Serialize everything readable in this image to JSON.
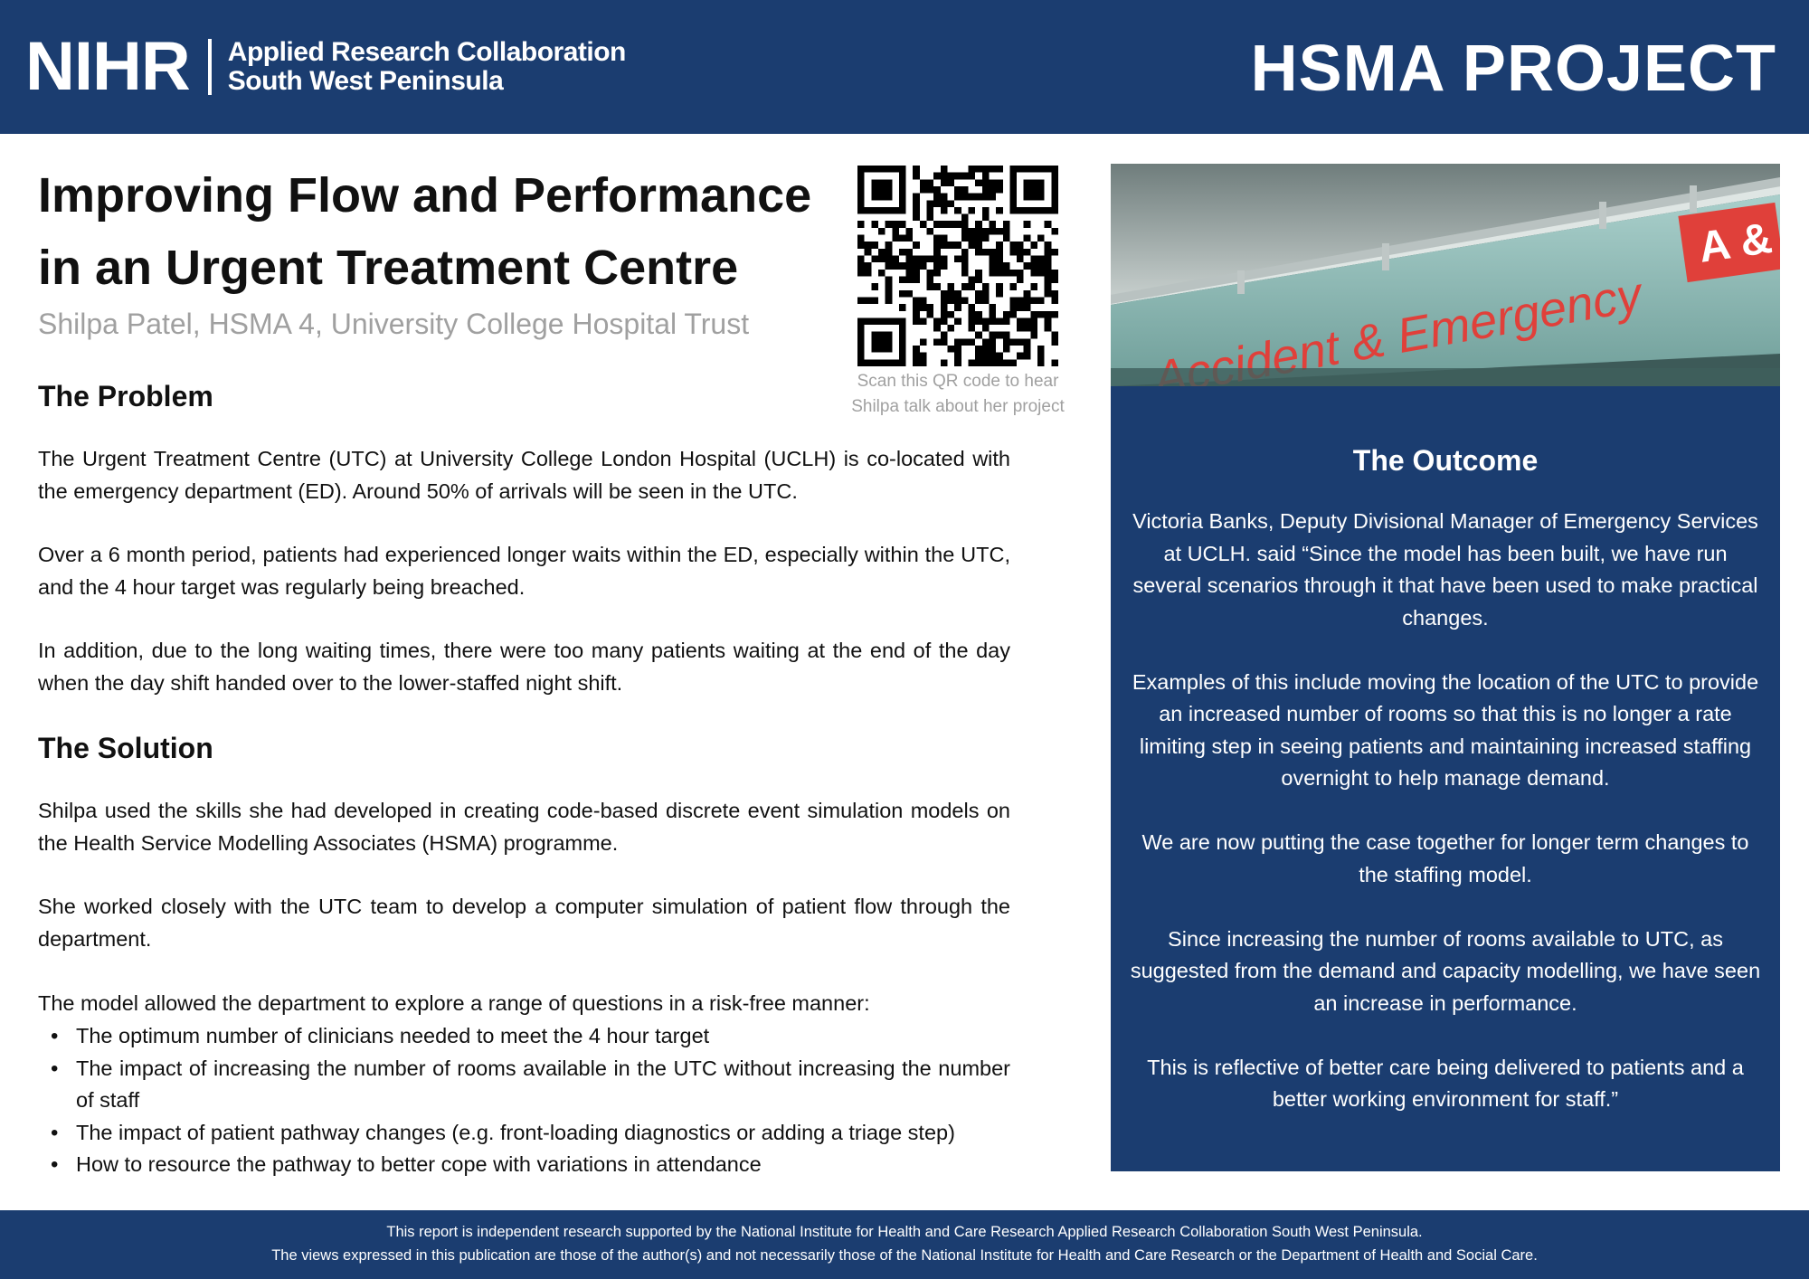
{
  "header": {
    "logo_mark": "NIHR",
    "org_line1": "Applied Research Collaboration",
    "org_line2": "South West Peninsula",
    "badge": "HSMA PROJECT"
  },
  "title": {
    "line1": "Improving Flow and Performance",
    "line2": "in an Urgent Treatment Centre",
    "byline": "Shilpa Patel, HSMA 4, University College Hospital Trust"
  },
  "qr": {
    "caption_line1": "Scan this QR code to hear",
    "caption_line2": "Shilpa talk about her project"
  },
  "problem": {
    "heading": "The Problem",
    "paragraphs": [
      "The Urgent Treatment Centre (UTC) at University College London Hospital (UCLH) is co-located with the emergency department (ED). Around 50% of arrivals will be seen in the UTC.",
      "Over a 6 month period, patients had experienced longer waits within the ED, especially within the UTC, and the 4 hour target was regularly being breached.",
      "In addition, due to the long waiting times, there were too many patients waiting at the end of the day when the day shift handed over to the lower-staffed night shift."
    ]
  },
  "solution": {
    "heading": "The Solution",
    "paragraphs": [
      "Shilpa used the skills she had developed in creating code-based discrete event simulation models on the Health Service Modelling Associates (HSMA) programme.",
      "She worked closely with the UTC team to develop a computer simulation of patient flow through the department.",
      "The model allowed the department to explore a range of questions in a risk-free manner:"
    ],
    "bullets": [
      "The optimum number of clinicians needed to meet the 4 hour target",
      "The impact of increasing the number of rooms available in the UTC without increasing the number of staff",
      "The impact of patient pathway changes (e.g. front-loading diagnostics or adding a triage step)",
      "How to resource the pathway to better cope with variations in attendance"
    ]
  },
  "photo": {
    "sign_text": "Accident & Emergency",
    "sign_badge": "A &"
  },
  "outcome": {
    "heading": "The Outcome",
    "paragraphs": [
      "Victoria Banks, Deputy Divisional Manager of Emergency Services at UCLH. said “Since the model has been built, we have run several scenarios through it that have been used to make practical changes.",
      "Examples of this include moving the location of the UTC to provide an increased number of rooms so that this is no longer a rate limiting step in seeing patients and maintaining increased staffing overnight to help manage demand.",
      "We are now putting the case together for longer term changes to the staffing model.",
      "Since increasing the number of rooms available to UTC, as suggested from the demand and capacity modelling, we have seen an increase in performance.",
      "This is reflective of better care being delivered to patients and a better working environment for staff.”"
    ]
  },
  "footer": {
    "line1": "This report is independent research supported by the National Institute for Health and Care Research Applied Research Collaboration South West Peninsula.",
    "line2": "The views expressed in this publication are those of the author(s) and not necessarily those of the National Institute for Health and Care Research or the Department of Health and Social Care."
  },
  "colors": {
    "navy": "#1b3d70",
    "byline_grey": "#a0a0a0",
    "sign_red": "#e0403a"
  }
}
